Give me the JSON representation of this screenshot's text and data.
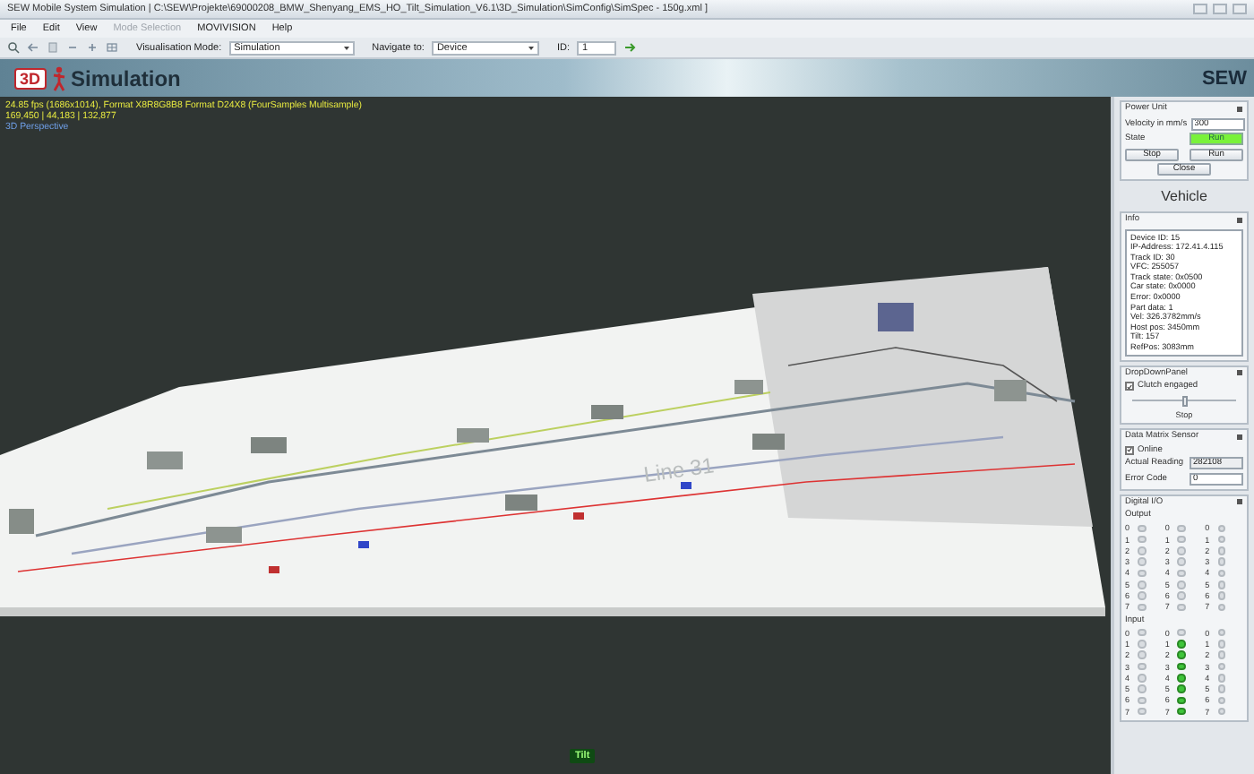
{
  "window": {
    "title": "SEW Mobile System Simulation | C:\\SEW\\Projekte\\69000208_BMW_Shenyang_EMS_HO_Tilt_Simulation_V6.1\\3D_Simulation\\SimConfig\\SimSpec - 150g.xml ]"
  },
  "menu": [
    {
      "label": "File",
      "disabled": false
    },
    {
      "label": "Edit",
      "disabled": false
    },
    {
      "label": "View",
      "disabled": false
    },
    {
      "label": "Mode Selection",
      "disabled": true
    },
    {
      "label": "MOVIVISION",
      "disabled": false
    },
    {
      "label": "Help",
      "disabled": false
    }
  ],
  "toolbar": {
    "visualisation_mode": {
      "label": "Visualisation Mode:",
      "value": "Simulation"
    },
    "navigate_to": {
      "label": "Navigate to:",
      "value": "Device"
    },
    "id": {
      "label": "ID:",
      "value": "1"
    }
  },
  "banner": {
    "logo_badge": "3D",
    "title": "Simulation",
    "brand": "SEW"
  },
  "viewport": {
    "overlay": [
      {
        "kind": "stats",
        "text": "24.85 fps (1686x1014), Format X8R8G8B8 Format D24X8 (FourSamples Multisample)"
      },
      {
        "kind": "stats",
        "text": "169,450 | 44,183 | 132,877"
      },
      {
        "kind": "view",
        "text": "3D Perspective"
      }
    ],
    "floor_label": "Line 31",
    "tilt_badge": "Tilt"
  },
  "power_unit": {
    "title": "Power Unit",
    "velocity": {
      "label": "Velocity in mm/s",
      "value": "300"
    },
    "state": {
      "label": "State",
      "value": "Run",
      "active": true
    },
    "buttons": [
      "Stop",
      "Run"
    ],
    "close": "Close"
  },
  "vehicle_heading": "Vehicle",
  "info": {
    "title": "Info",
    "lines": [
      "Device ID: 15",
      "IP-Address: 172.41.4.115",
      "Track ID: 30",
      "VFC: 255057",
      "Track state: 0x0500",
      "Car state: 0x0000",
      "Error: 0x0000",
      "Part data: 1",
      "Vel: 326.3782mm/s",
      "Host pos: 3450mm",
      "Tilt: 157",
      "RefPos: 3083mm"
    ]
  },
  "drop_down_panel": {
    "title": "DropDownPanel",
    "clutch": {
      "label": "Clutch engaged",
      "checked": true
    },
    "slider": {
      "level": 0.5
    },
    "slider_label": "Stop"
  },
  "data_matrix_sensor": {
    "title": "Data Matrix Sensor",
    "online": {
      "label": "Online",
      "checked": true
    },
    "actual_reading": {
      "label": "Actual Reading",
      "value": "282108",
      "disabled": true
    },
    "error_code": {
      "label": "Error Code",
      "value": "0",
      "disabled": false
    }
  },
  "digital_io": {
    "title": "Digital I/O",
    "groups": [
      {
        "label": "Output",
        "columns": [
          [
            {
              "label": "0",
              "on": false
            },
            {
              "label": "1",
              "on": false
            },
            {
              "label": "2",
              "on": false
            },
            {
              "label": "3",
              "on": false
            },
            {
              "label": "4",
              "on": false
            },
            {
              "label": "5",
              "on": false
            },
            {
              "label": "6",
              "on": false
            },
            {
              "label": "7",
              "on": false
            }
          ],
          [
            {
              "label": "0",
              "on": false
            },
            {
              "label": "1",
              "on": false
            },
            {
              "label": "2",
              "on": false
            },
            {
              "label": "3",
              "on": false
            },
            {
              "label": "4",
              "on": false
            },
            {
              "label": "5",
              "on": false
            },
            {
              "label": "6",
              "on": false
            },
            {
              "label": "7",
              "on": false
            }
          ],
          [
            {
              "label": "0",
              "on": false
            },
            {
              "label": "1",
              "on": false
            },
            {
              "label": "2",
              "on": false
            },
            {
              "label": "3",
              "on": false
            },
            {
              "label": "4",
              "on": false
            },
            {
              "label": "5",
              "on": false
            },
            {
              "label": "6",
              "on": false
            },
            {
              "label": "7",
              "on": false
            }
          ]
        ]
      },
      {
        "label": "Input",
        "columns": [
          [
            {
              "label": "0",
              "on": false
            },
            {
              "label": "1",
              "on": false
            },
            {
              "label": "2",
              "on": false
            },
            {
              "label": "3",
              "on": false
            },
            {
              "label": "4",
              "on": false
            },
            {
              "label": "5",
              "on": false
            },
            {
              "label": "6",
              "on": false
            },
            {
              "label": "7",
              "on": false
            }
          ],
          [
            {
              "label": "0",
              "on": false
            },
            {
              "label": "1",
              "on": true
            },
            {
              "label": "2",
              "on": true
            },
            {
              "label": "3",
              "on": true
            },
            {
              "label": "4",
              "on": true
            },
            {
              "label": "5",
              "on": true
            },
            {
              "label": "6",
              "on": true
            },
            {
              "label": "7",
              "on": true
            }
          ],
          [
            {
              "label": "0",
              "on": false
            },
            {
              "label": "1",
              "on": false
            },
            {
              "label": "2",
              "on": false
            },
            {
              "label": "3",
              "on": false
            },
            {
              "label": "4",
              "on": false
            },
            {
              "label": "5",
              "on": false
            },
            {
              "label": "6",
              "on": false
            },
            {
              "label": "7",
              "on": false
            }
          ]
        ]
      }
    ]
  }
}
